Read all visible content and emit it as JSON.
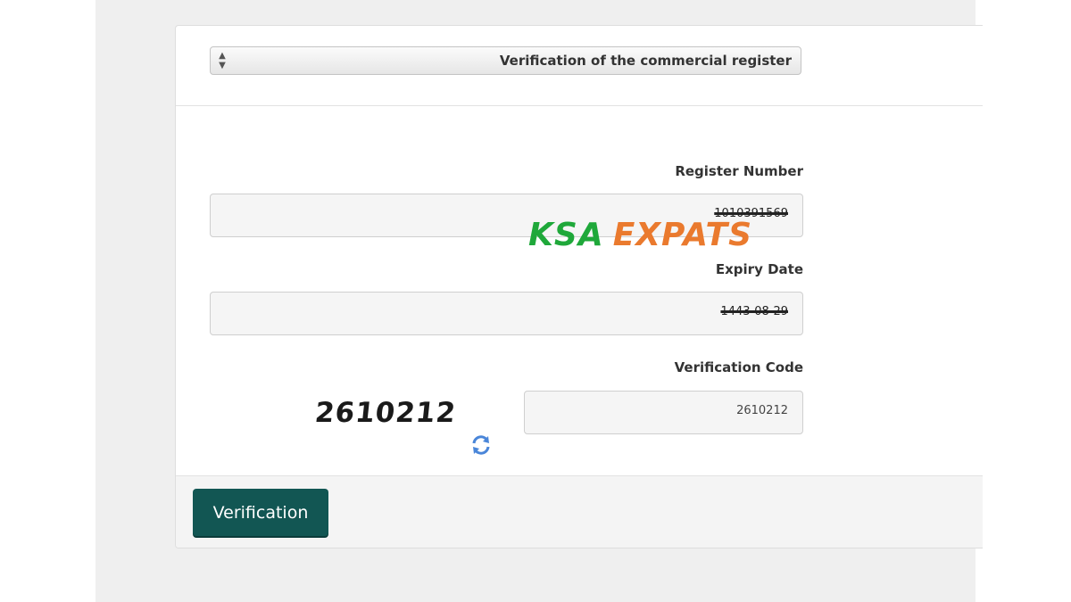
{
  "form": {
    "select_value": "Verification of the commercial register",
    "register_number_label": "Register Number",
    "register_number_value": "1010391569",
    "expiry_date_label": "Expiry Date",
    "expiry_date_value": "1443-08-29",
    "verification_code_label": "Verification Code",
    "captcha_text": "2610212",
    "verification_code_value": "2610212",
    "submit_label": "Verification"
  },
  "watermark": {
    "part1": "KSA",
    "part2": "EXPATS",
    "colors": {
      "part1": "#1fa83a",
      "part2": "#ea7a2e"
    }
  },
  "icons": {
    "select_arrows": "up-down-arrows-icon",
    "refresh": "refresh-icon"
  },
  "colors": {
    "button": "#125653",
    "background": "#efefef"
  }
}
